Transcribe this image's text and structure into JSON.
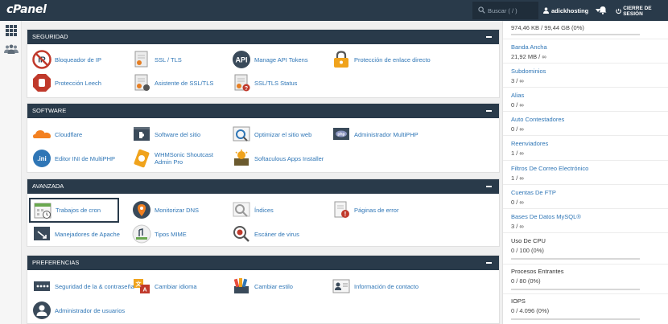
{
  "app": {
    "logo": "cPanel"
  },
  "header": {
    "search_placeholder": "Buscar ( / )",
    "username": "adickhosting",
    "logout_label": "CIERRE DE SESIÓN"
  },
  "sections": {
    "seguridad": {
      "title": "SEGURIDAD",
      "items": [
        "Bloqueador de IP",
        "SSL / TLS",
        "Manage API Tokens",
        "Protección de enlace directo",
        "Protección Leech",
        "Asistente de SSL/TLS",
        "SSL/TLS Status"
      ]
    },
    "software": {
      "title": "SOFTWARE",
      "items": [
        "Cloudflare",
        "Software del sitio",
        "Optimizar el sitio web",
        "Administrador MultiPHP",
        "Editor INI de MultiPHP",
        "WHMSonic Shoutcast Admin Pro",
        "Softaculous Apps Installer"
      ]
    },
    "avanzada": {
      "title": "AVANZADA",
      "items": [
        "Trabajos de cron",
        "Monitorizar DNS",
        "Índices",
        "Páginas de error",
        "Manejadores de Apache",
        "Tipos MIME",
        "Escáner de virus"
      ]
    },
    "preferencias": {
      "title": "PREFERENCIAS",
      "items": [
        "Seguridad de la & contraseña",
        "Cambiar idioma",
        "Cambiar estilo",
        "Información de contacto",
        "Administrador de usuarios"
      ]
    }
  },
  "stats": [
    {
      "name": "",
      "value": "974,46 KB / 99,44 GB   (0%)",
      "bar_percent": 0
    },
    {
      "name": "Banda Ancha",
      "value": "21,92 MB / ∞"
    },
    {
      "name": "Subdominios",
      "value": "3 / ∞"
    },
    {
      "name": "Alias",
      "value": "0 / ∞"
    },
    {
      "name": "Auto Contestadores",
      "value": "0 / ∞"
    },
    {
      "name": "Reenviadores",
      "value": "1 / ∞"
    },
    {
      "name": "Filtros De Correo Electrónico",
      "value": "1 / ∞"
    },
    {
      "name": "Cuentas De FTP",
      "value": "0 / ∞"
    },
    {
      "name": "Bases De Datos MySQL®",
      "value": "3 / ∞"
    },
    {
      "name": "Uso De CPU",
      "value": "0 / 100   (0%)",
      "bar_percent": 0
    },
    {
      "name": "Procesos Entrantes",
      "value": "0 / 80   (0%)",
      "bar_percent": 0
    },
    {
      "name": "IOPS",
      "value": "0 / 4.096   (0%)",
      "bar_percent": 0
    }
  ],
  "colors": {
    "header_bg": "#293a4a",
    "link": "#2f76b6",
    "bar_fill": "#2f76b6"
  }
}
